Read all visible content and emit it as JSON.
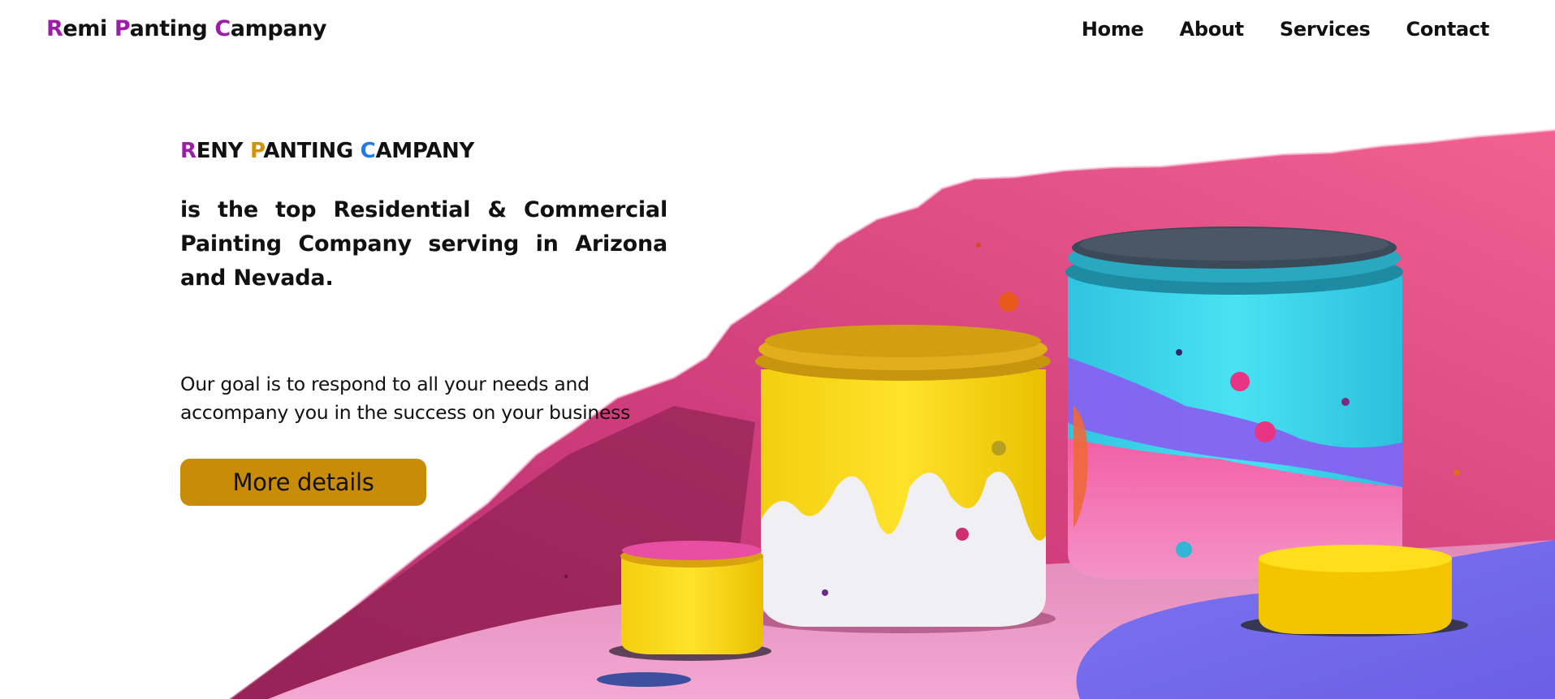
{
  "brand": {
    "parts": [
      {
        "initial": "R",
        "rest": "emi "
      },
      {
        "initial": "P",
        "rest": "anting "
      },
      {
        "initial": "C",
        "rest": "ampany"
      }
    ]
  },
  "nav": {
    "items": [
      "Home",
      "About",
      "Services",
      "Contact"
    ]
  },
  "hero": {
    "eyebrow": [
      {
        "initial": "R",
        "rest": "ENY "
      },
      {
        "initial": "P",
        "rest": "ANTING "
      },
      {
        "initial": "C",
        "rest": "AMPANY"
      }
    ],
    "headline": "is the top Residential & Commercial Painting Company serving in Arizona and Nevada.",
    "goal_line1": "Our goal is to respond to all your needs and",
    "goal_line2": "accompany you in the success on your business",
    "cta_label": "More details"
  },
  "colors": {
    "brand_initial": "#9c1ea8",
    "eyebrow_initial_1": "#9c1ea8",
    "eyebrow_initial_2": "#d3930a",
    "eyebrow_initial_3": "#1f7bf2",
    "cta_background": "#c98c06"
  },
  "images": {
    "hero_illustration": "paint-cans-splash-illustration"
  }
}
